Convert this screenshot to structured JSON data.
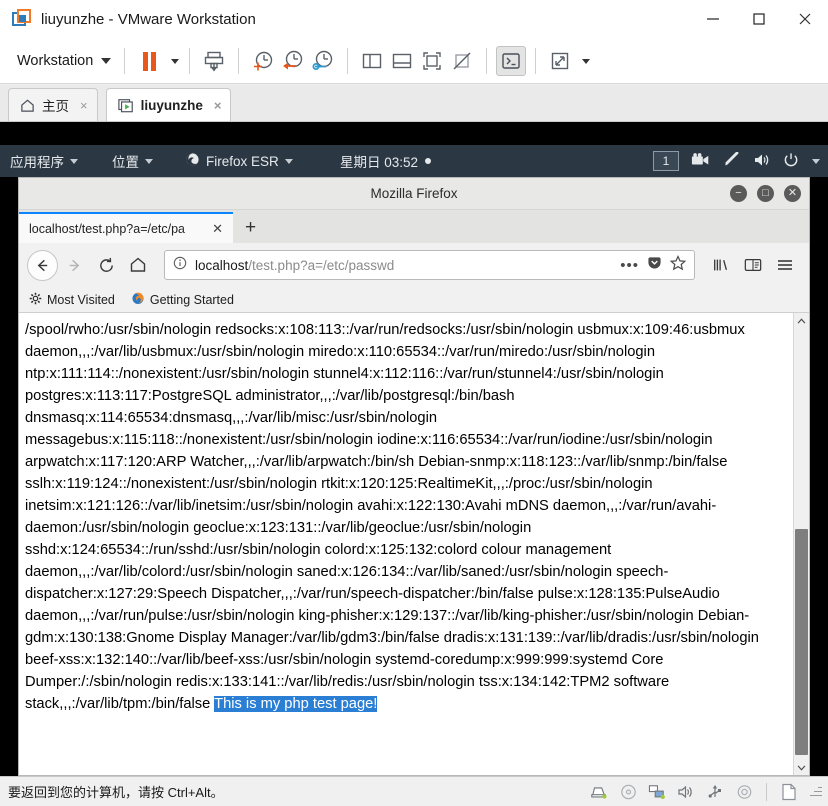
{
  "vmware": {
    "window_title": "liuyunzhe - VMware Workstation",
    "logo_icon": "vmware-logo-icon",
    "window_controls": {
      "minimize": "minimize-icon",
      "maximize": "maximize-icon",
      "close": "close-icon"
    },
    "toolbar": {
      "workstation_label": "Workstation",
      "buttons": [
        {
          "name": "pause-vm-button",
          "icon": "pause-icon"
        },
        {
          "name": "pause-dropdown-button",
          "icon": "chevron-down-icon"
        },
        {
          "name": "install-tools-button",
          "icon": "printer-download-icon"
        },
        {
          "name": "take-snapshot-button",
          "icon": "clock-plus-icon"
        },
        {
          "name": "revert-snapshot-button",
          "icon": "clock-back-icon"
        },
        {
          "name": "manage-snapshots-button",
          "icon": "clock-wrench-icon"
        },
        {
          "name": "show-library-button",
          "icon": "panel-left-icon"
        },
        {
          "name": "show-thumbnail-bar-button",
          "icon": "panel-bottom-icon"
        },
        {
          "name": "full-screen-button",
          "icon": "fullscreen-icon"
        },
        {
          "name": "unity-mode-button",
          "icon": "unity-off-icon"
        },
        {
          "name": "console-button",
          "icon": "terminal-icon"
        },
        {
          "name": "stretch-button",
          "icon": "expand-arrows-icon"
        },
        {
          "name": "stretch-dropdown-button",
          "icon": "chevron-down-icon"
        }
      ]
    },
    "tabs": [
      {
        "label": "主页",
        "icon": "home-icon",
        "selected": false,
        "close": "×"
      },
      {
        "label": "liuyunzhe",
        "icon": "vm-screen-icon",
        "selected": true,
        "close": "×"
      }
    ],
    "status": {
      "message": "要返回到您的计算机，请按 Ctrl+Alt。",
      "icons": [
        "hard-disk-icon",
        "cd-dvd-icon",
        "network-adapter-icon",
        "sound-card-icon",
        "usb-device-icon",
        "printer-icon",
        "display-icon"
      ]
    }
  },
  "guest": {
    "panel": {
      "applications_label": "应用程序",
      "places_label": "位置",
      "firefox_label": "Firefox ESR",
      "firefox_icon": "firefox-icon",
      "clock": "星期日 03:52",
      "workspace_badge": "1",
      "tray_icons": [
        "screencast-icon",
        "pen-tablet-icon",
        "volume-icon",
        "power-icon",
        "chevron-down-icon"
      ]
    },
    "firefox": {
      "window_title": "Mozilla Firefox",
      "window_controls": {
        "minimize": "−",
        "restore": "□",
        "close": "✕"
      },
      "tab": {
        "label": "localhost/test.php?a=/etc/pa",
        "close": "✕"
      },
      "new_tab": "+",
      "nav": {
        "back_icon": "arrow-left-icon",
        "forward_icon": "arrow-right-icon",
        "reload_icon": "reload-icon",
        "home_icon": "home-icon",
        "library_icon": "library-icon",
        "sidebar_icon": "sidebar-icon",
        "menu_icon": "hamburger-menu-icon"
      },
      "urlbar": {
        "info_icon": "page-info-icon",
        "host": "localhost",
        "path": "/test.php?a=/etc/passwd",
        "page_actions_icon": "ellipsis-icon",
        "pocket_icon": "pocket-icon",
        "bookmark_icon": "star-icon"
      },
      "bookmarks": [
        {
          "label": "Most Visited",
          "icon": "gear-icon"
        },
        {
          "label": "Getting Started",
          "icon": "firefox-icon"
        }
      ],
      "page": {
        "body_text": "/spool/rwho:/usr/sbin/nologin redsocks:x:108:113::/var/run/redsocks:/usr/sbin/nologin usbmux:x:109:46:usbmux daemon,,,:/var/lib/usbmux:/usr/sbin/nologin miredo:x:110:65534::/var/run/miredo:/usr/sbin/nologin ntp:x:111:114::/nonexistent:/usr/sbin/nologin stunnel4:x:112:116::/var/run/stunnel4:/usr/sbin/nologin postgres:x:113:117:PostgreSQL administrator,,,:/var/lib/postgresql:/bin/bash dnsmasq:x:114:65534:dnsmasq,,,:/var/lib/misc:/usr/sbin/nologin messagebus:x:115:118::/nonexistent:/usr/sbin/nologin iodine:x:116:65534::/var/run/iodine:/usr/sbin/nologin arpwatch:x:117:120:ARP Watcher,,,:/var/lib/arpwatch:/bin/sh Debian-snmp:x:118:123::/var/lib/snmp:/bin/false sslh:x:119:124::/nonexistent:/usr/sbin/nologin rtkit:x:120:125:RealtimeKit,,,:/proc:/usr/sbin/nologin inetsim:x:121:126::/var/lib/inetsim:/usr/sbin/nologin avahi:x:122:130:Avahi mDNS daemon,,,:/var/run/avahi-daemon:/usr/sbin/nologin geoclue:x:123:131::/var/lib/geoclue:/usr/sbin/nologin sshd:x:124:65534::/run/sshd:/usr/sbin/nologin colord:x:125:132:colord colour management daemon,,,:/var/lib/colord:/usr/sbin/nologin saned:x:126:134::/var/lib/saned:/usr/sbin/nologin speech-dispatcher:x:127:29:Speech Dispatcher,,,:/var/run/speech-dispatcher:/bin/false pulse:x:128:135:PulseAudio daemon,,,:/var/run/pulse:/usr/sbin/nologin king-phisher:x:129:137::/var/lib/king-phisher:/usr/sbin/nologin Debian-gdm:x:130:138:Gnome Display Manager:/var/lib/gdm3:/bin/false dradis:x:131:139::/var/lib/dradis:/usr/sbin/nologin beef-xss:x:132:140::/var/lib/beef-xss:/usr/sbin/nologin systemd-coredump:x:999:999:systemd Core Dumper:/:/sbin/nologin redis:x:133:141::/var/lib/redis:/usr/sbin/nologin tss:x:134:142:TPM2 software stack,,,:/var/lib/tpm:/bin/false ",
        "highlighted_text": "This is my php test page!",
        "highlight_color": "#2a7fd4"
      },
      "scrollbar": {
        "up_arrow": "▲",
        "down_arrow": "▼"
      }
    }
  }
}
